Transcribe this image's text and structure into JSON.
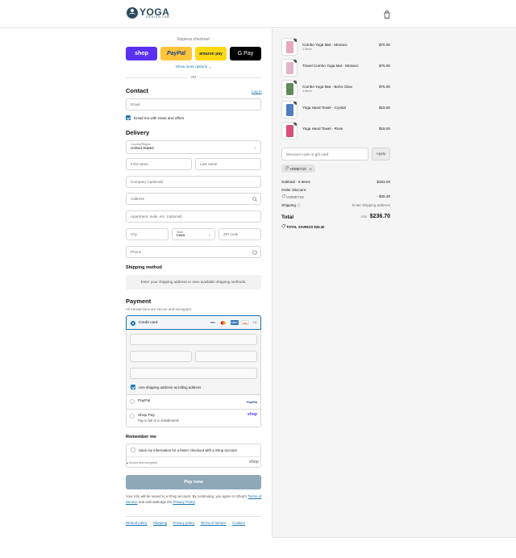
{
  "header": {
    "brand_main": "YOGA",
    "brand_sub": "DESIGN LAB",
    "cart_icon": "shopping-bag-icon"
  },
  "express": {
    "title": "Express checkout",
    "shop_label": "shop",
    "paypal_label": "PayPal",
    "amazon_label": "amazon pay",
    "gpay_label": "G Pay",
    "more_options": "Show more options ⌄",
    "or_label": "OR"
  },
  "contact": {
    "title": "Contact",
    "login_link": "Log in",
    "email_placeholder": "Email",
    "news_label": "Email me with news and offers"
  },
  "delivery": {
    "title": "Delivery",
    "country_label": "Country/Region",
    "country_value": "United States",
    "first_name": "First name",
    "last_name": "Last name",
    "company": "Company (optional)",
    "address": "Address",
    "apartment": "Apartment, suite, etc. (optional)",
    "city": "City",
    "state_label": "State",
    "state_value": "Iowa",
    "zip": "ZIP code",
    "phone": "Phone"
  },
  "shipping": {
    "title": "Shipping method",
    "notice": "Enter your shipping address to view available shipping methods."
  },
  "payment": {
    "title": "Payment",
    "subtitle": "All transactions are secure and encrypted.",
    "credit_card_label": "Credit card",
    "card_brands": [
      "VISA",
      "MC",
      "AMEX",
      "DISC"
    ],
    "more_brands": "+4",
    "billing_label": "Use shipping address as billing address",
    "paypal_label": "PayPal",
    "paypal_brand": "PayPal",
    "shoppay_label": "Shop Pay",
    "shoppay_sub": "Pay in full or in installments",
    "shoppay_brand": "shop"
  },
  "remember": {
    "title": "Remember me",
    "save_label": "Save my information for a faster checkout with a Shop account",
    "secure_label": "Secure and encrypted",
    "shop_brand": "shop"
  },
  "pay_now": "Pay now",
  "legal": {
    "text_1": "Your info will be saved to a Shop account. By continuing, you agree to Shop's",
    "tos": "Terms of Service",
    "text_2": "and acknowledge the",
    "privacy": "Privacy Policy",
    "end": "."
  },
  "footer": {
    "links": [
      "Refund policy",
      "Shipping",
      "Privacy policy",
      "Terms of service",
      "Cookies"
    ]
  },
  "cart": {
    "items": [
      {
        "name": "Combo Yoga Mat - Monaco",
        "variant": "1.0mm",
        "price": "$75.00",
        "qty": "1",
        "color": "#e8a7c0"
      },
      {
        "name": "Travel Combo Yoga Mat - Monaco",
        "variant": "",
        "price": "$75.00",
        "qty": "1",
        "color": "#e3b3c8"
      },
      {
        "name": "Combo Yoga Mat - Boho Glow",
        "variant": "1.5mm",
        "price": "$75.00",
        "qty": "1",
        "color": "#5f8a5a"
      },
      {
        "name": "Yoga Hand Towel - Crystal",
        "variant": "",
        "price": "$19.00",
        "qty": "1",
        "color": "#4f7fbf"
      },
      {
        "name": "Yoga Hand Towel - Rose",
        "variant": "",
        "price": "$19.00",
        "qty": "1",
        "color": "#d84f7a"
      }
    ],
    "discount_placeholder": "Discount code or gift card",
    "apply_label": "Apply",
    "applied_code": "HONEY10",
    "subtotal_label": "Subtotal · 5 items",
    "subtotal_value": "$263.00",
    "order_discount_label": "Order discount",
    "discount_code": "HONEY10",
    "discount_value": "- $26.30",
    "shipping_label": "Shipping",
    "shipping_value": "Enter shipping address",
    "total_label": "Total",
    "currency": "USD",
    "total_value": "$236.70",
    "savings_label": "TOTAL SAVINGS",
    "savings_value": "$26.30"
  }
}
